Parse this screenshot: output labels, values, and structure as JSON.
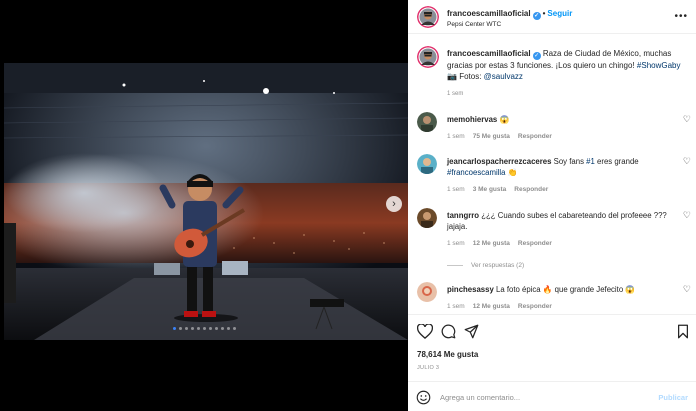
{
  "post": {
    "username": "francoescamillaoficial",
    "follow_label": "Seguir",
    "location": "Pepsi Center WTC",
    "more_icon": "more-horizontal-icon"
  },
  "caption": {
    "username": "francoescamillaoficial",
    "text": "Raza de Ciudad de México, muchas gracias por estas 3 funciones. ¡Los quiero un chingo!",
    "hashtag": "#ShowGaby",
    "photos_label": "Fotos:",
    "photo_credit": "@saulvazz",
    "time": "1 sem"
  },
  "comments": [
    {
      "username": "memohiervas",
      "text": "😱",
      "time": "1 sem",
      "likes": "75 Me gusta",
      "reply": "Responder"
    },
    {
      "username": "jeancarlospacherrezcaceres",
      "text": "Soy fans",
      "hashtag": "#1",
      "text2": "eres grande",
      "mention": "#francoescamilla",
      "emoji": "👏",
      "time": "1 sem",
      "likes": "3 Me gusta",
      "reply": "Responder"
    },
    {
      "username": "tanngrro",
      "text": "¿¿¿ Cuando subes el cabareteando del profeeee ??? jajaja.",
      "time": "1 sem",
      "likes": "12 Me gusta",
      "reply": "Responder"
    },
    {
      "username": "pinchesassy",
      "text": "La foto épica 🔥 que grande Jefecito 😱",
      "time": "1 sem",
      "likes": "12 Me gusta",
      "reply": "Responder"
    }
  ],
  "view_replies": "Ver respuestas (2)",
  "likes_count": "78,614 Me gusta",
  "date": "JULIO 3",
  "comment_input": {
    "placeholder": "Agrega un comentario...",
    "publish_label": "Publicar"
  },
  "carousel": {
    "total_slides": 11,
    "active_index": 0
  },
  "colors": {
    "accent": "#0095f6",
    "verified": "#3897f0",
    "active_dot": "#3b82f6"
  },
  "icons": [
    "heart-icon",
    "comment-icon",
    "share-icon",
    "bookmark-icon",
    "emoji-icon",
    "next-arrow-icon",
    "verified-icon"
  ]
}
